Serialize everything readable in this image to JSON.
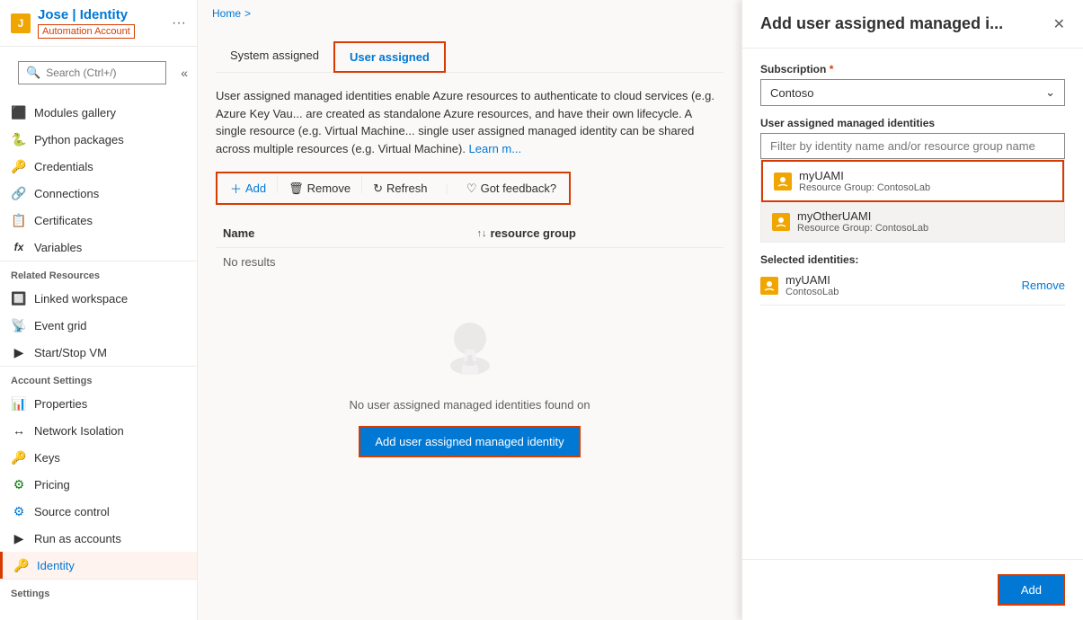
{
  "breadcrumb": {
    "home": "Home",
    "sep": ">"
  },
  "header": {
    "logo": "J",
    "title": "Jose | Identity",
    "subtitle": "Automation Account",
    "dots": "···"
  },
  "search": {
    "placeholder": "Search (Ctrl+/)"
  },
  "sidebar": {
    "items": [
      {
        "id": "modules-gallery",
        "label": "Modules gallery",
        "icon": "⬛"
      },
      {
        "id": "python-packages",
        "label": "Python packages",
        "icon": "🐍"
      },
      {
        "id": "credentials",
        "label": "Credentials",
        "icon": "🔑"
      },
      {
        "id": "connections",
        "label": "Connections",
        "icon": "🔗"
      },
      {
        "id": "certificates",
        "label": "Certificates",
        "icon": "📋"
      },
      {
        "id": "variables",
        "label": "Variables",
        "icon": "fx"
      }
    ],
    "related_resources_label": "Related Resources",
    "related_resources": [
      {
        "id": "linked-workspace",
        "label": "Linked workspace",
        "icon": "🔲"
      },
      {
        "id": "event-grid",
        "label": "Event grid",
        "icon": "📡"
      },
      {
        "id": "start-stop-vm",
        "label": "Start/Stop VM",
        "icon": "▶"
      }
    ],
    "account_settings_label": "Account Settings",
    "account_settings": [
      {
        "id": "properties",
        "label": "Properties",
        "icon": "📊"
      },
      {
        "id": "network-isolation",
        "label": "Network Isolation",
        "icon": "↔"
      },
      {
        "id": "keys",
        "label": "Keys",
        "icon": "🔑"
      },
      {
        "id": "pricing",
        "label": "Pricing",
        "icon": "⚙"
      },
      {
        "id": "source-control",
        "label": "Source control",
        "icon": "⚙"
      },
      {
        "id": "run-as-accounts",
        "label": "Run as accounts",
        "icon": "▶"
      },
      {
        "id": "identity",
        "label": "Identity",
        "icon": "🔑"
      }
    ],
    "settings_label": "Settings"
  },
  "main": {
    "tabs": [
      {
        "id": "system-assigned",
        "label": "System assigned",
        "active": false
      },
      {
        "id": "user-assigned",
        "label": "User assigned",
        "active": true
      }
    ],
    "description": "User assigned managed identities enable Azure resources to authenticate to cloud services (e.g. Azure Key Vau... are created as standalone Azure resources, and have their own lifecycle. A single resource (e.g. Virtual Machine... single user assigned managed identity can be shared across multiple resources (e.g. Virtual Machine). Learn mo...",
    "toolbar": {
      "add_label": "Add",
      "remove_label": "Remove",
      "refresh_label": "Refresh",
      "feedback_label": "Got feedback?"
    },
    "table": {
      "col_name": "Name",
      "col_sort": "↑↓",
      "col_resource_group": "resource group"
    },
    "no_results": "No results",
    "empty_state": {
      "message": "No user assigned managed identities found on",
      "button": "Add user assigned managed identity"
    }
  },
  "panel": {
    "title": "Add user assigned managed i...",
    "close_icon": "✕",
    "subscription_label": "Subscription",
    "subscription_required": "*",
    "subscription_value": "Contoso",
    "identities_label": "User assigned managed identities",
    "filter_placeholder": "Filter by identity name and/or resource group name",
    "identities": [
      {
        "id": "myUAMI",
        "name": "myUAMI",
        "resource_group": "Resource Group: ContosoLab",
        "selected": true
      },
      {
        "id": "myOtherUAMI",
        "name": "myOtherUAMI",
        "resource_group": "Resource Group: ContosoLab",
        "selected": false
      }
    ],
    "selected_label": "Selected identities:",
    "selected_items": [
      {
        "name": "myUAMI",
        "lab": "ContosoLab",
        "remove": "Remove"
      }
    ],
    "add_button": "Add"
  }
}
